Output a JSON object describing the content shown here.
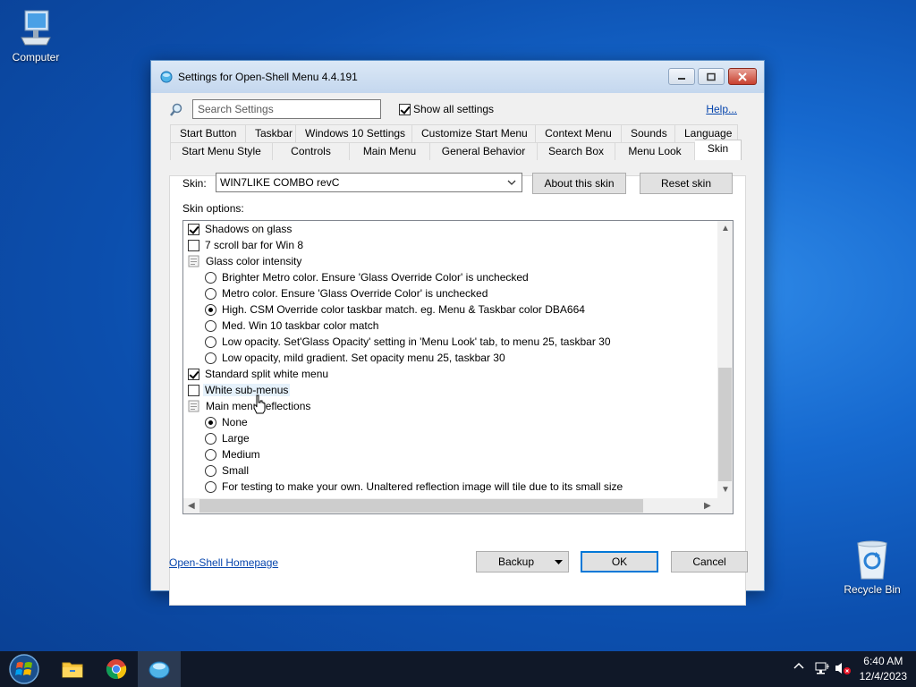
{
  "desktop": {
    "icons": [
      {
        "label": "Computer",
        "icon": "computer-icon"
      },
      {
        "label": "Recycle Bin",
        "icon": "recycle-bin-icon"
      }
    ]
  },
  "window": {
    "title": "Settings for Open-Shell Menu 4.4.191",
    "search_placeholder": "Search Settings",
    "show_all_label": "Show all settings",
    "show_all_checked": true,
    "help_link": "Help...",
    "tabs_row1": [
      "Start Button",
      "Taskbar",
      "Windows 10 Settings",
      "Customize Start Menu",
      "Context Menu",
      "Sounds",
      "Language"
    ],
    "tabs_row2": [
      "Start Menu Style",
      "Controls",
      "Main Menu",
      "General Behavior",
      "Search Box",
      "Menu Look",
      "Skin"
    ],
    "active_tab": "Skin",
    "skin_label": "Skin:",
    "skin_value": "WIN7LIKE COMBO revC",
    "about_skin_button": "About this skin",
    "reset_skin_button": "Reset skin",
    "skin_options_label": "Skin options:",
    "options": [
      {
        "type": "checkbox",
        "checked": true,
        "indent": 0,
        "label": "Shadows on glass"
      },
      {
        "type": "checkbox",
        "checked": false,
        "indent": 0,
        "label": "7 scroll bar for Win 8"
      },
      {
        "type": "group",
        "indent": 0,
        "label": "Glass color intensity"
      },
      {
        "type": "radio",
        "checked": false,
        "indent": 1,
        "label": "Brighter Metro color. Ensure 'Glass Override Color' is unchecked"
      },
      {
        "type": "radio",
        "checked": false,
        "indent": 1,
        "label": "Metro color.  Ensure 'Glass Override Color' is unchecked"
      },
      {
        "type": "radio",
        "checked": true,
        "indent": 1,
        "label": "High. CSM Override color taskbar match. eg. Menu & Taskbar color DBA664"
      },
      {
        "type": "radio",
        "checked": false,
        "indent": 1,
        "label": "Med. Win 10 taskbar color match"
      },
      {
        "type": "radio",
        "checked": false,
        "indent": 1,
        "label": "Low opacity. Set'Glass Opacity' setting in 'Menu Look' tab, to menu 25, taskbar 30"
      },
      {
        "type": "radio",
        "checked": false,
        "indent": 1,
        "label": "Low opacity, mild gradient. Set opacity  menu 25, taskbar 30"
      },
      {
        "type": "checkbox",
        "checked": true,
        "indent": 0,
        "label": "Standard split white menu"
      },
      {
        "type": "checkbox",
        "checked": false,
        "indent": 0,
        "label": "White sub-menus",
        "highlighted": true
      },
      {
        "type": "group",
        "indent": 0,
        "label": "Main menu reflections"
      },
      {
        "type": "radio",
        "checked": true,
        "indent": 1,
        "label": "None"
      },
      {
        "type": "radio",
        "checked": false,
        "indent": 1,
        "label": "Large"
      },
      {
        "type": "radio",
        "checked": false,
        "indent": 1,
        "label": "Medium"
      },
      {
        "type": "radio",
        "checked": false,
        "indent": 1,
        "label": "Small"
      },
      {
        "type": "radio",
        "checked": false,
        "indent": 1,
        "label": "For testing to make your own. Unaltered reflection image will tile due to its small size"
      }
    ],
    "homepage_link": "Open-Shell Homepage",
    "backup_button": "Backup",
    "ok_button": "OK",
    "cancel_button": "Cancel"
  },
  "taskbar": {
    "pinned": [
      "start-orb-icon",
      "file-explorer-icon",
      "chrome-icon",
      "open-shell-icon"
    ],
    "time": "6:40 AM",
    "date": "12/4/2023"
  }
}
